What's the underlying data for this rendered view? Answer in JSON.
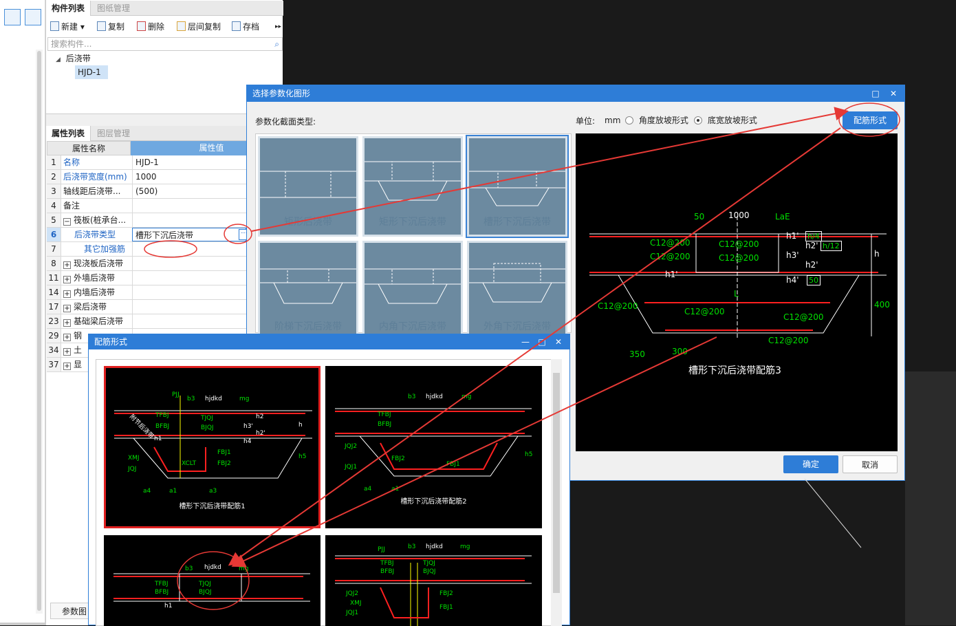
{
  "component_panel": {
    "tabs": [
      "构件列表",
      "图纸管理"
    ],
    "toolbar": [
      "新建",
      "复制",
      "删除",
      "层间复制",
      "存档"
    ],
    "search_placeholder": "搜索构件...",
    "tree": {
      "group": "后浇带",
      "item": "HJD-1"
    }
  },
  "property_panel": {
    "tabs": [
      "属性列表",
      "图层管理"
    ],
    "headers": {
      "name": "属性名称",
      "value": "属性值"
    },
    "rows": [
      {
        "num": "1",
        "name": "名称",
        "value": "HJD-1"
      },
      {
        "num": "2",
        "name": "后浇带宽度(mm)",
        "value": "1000"
      },
      {
        "num": "3",
        "name": "轴线距后浇带...",
        "value": "(500)"
      },
      {
        "num": "4",
        "name": "备注",
        "value": ""
      },
      {
        "num": "5",
        "name": "筏板(桩承台...",
        "value": ""
      },
      {
        "num": "6",
        "name": "后浇带类型",
        "value": "槽形下沉后浇带"
      },
      {
        "num": "7",
        "name": "其它加强筋",
        "value": ""
      },
      {
        "num": "8",
        "name": "现浇板后浇带",
        "value": ""
      },
      {
        "num": "11",
        "name": "外墙后浇带",
        "value": ""
      },
      {
        "num": "14",
        "name": "内墙后浇带",
        "value": ""
      },
      {
        "num": "17",
        "name": "梁后浇带",
        "value": ""
      },
      {
        "num": "23",
        "name": "基础梁后浇带",
        "value": ""
      },
      {
        "num": "29",
        "name": "钢",
        "value": ""
      },
      {
        "num": "34",
        "name": "土",
        "value": ""
      },
      {
        "num": "37",
        "name": "显",
        "value": ""
      }
    ],
    "bottom_button": "参数图"
  },
  "select_dialog": {
    "title": "选择参数化图形",
    "type_label": "参数化截面类型:",
    "unit_label": "单位:",
    "unit_value": "mm",
    "radio_angle": "角度放坡形式",
    "radio_bottom": "底宽放坡形式",
    "rebar_button": "配筋形式",
    "tiles": [
      "矩形后浇带",
      "矩形下沉后浇带",
      "槽形下沉后浇带",
      "阶梯下沉后浇带",
      "内角下沉后浇带",
      "外角下沉后浇带"
    ],
    "preview": {
      "caption": "槽形下沉后浇带配筋3",
      "dim_50": "50",
      "dim_1000": "1000",
      "dim_lae": "LaE",
      "rebar_1": "C12@200",
      "rebar_2": "C12@200",
      "rebar_3": "C12@200",
      "rebar_4": "C12@200",
      "rebar_5": "C12@200",
      "rebar_6": "C12@200",
      "rebar_7": "C12@200",
      "rebar_8": "C12@200",
      "h1": "h1'",
      "h2": "h2'",
      "h3": "h3'",
      "h2b": "h2'",
      "h1b": "h1'",
      "h4": "h4'",
      "h4_frac": "h/4",
      "h12_frac": "h/12",
      "v50": "50",
      "h": "h",
      "v400": "400",
      "l": "L",
      "d350": "350",
      "d300": "300"
    },
    "ok": "确定",
    "cancel": "取消"
  },
  "rebar_dialog": {
    "title": "配筋形式",
    "options": [
      {
        "caption": "槽形下沉后浇带配筋1"
      },
      {
        "caption": "槽形下沉后浇带配筋2"
      },
      {
        "caption": ""
      },
      {
        "caption": ""
      }
    ],
    "cad_labels": {
      "pjj": "PJJ",
      "b3": "b3",
      "hjdkd": "hjdkd",
      "mg": "mg",
      "tfbj": "TFBJ",
      "bfbj": "BFBJ",
      "tjqj": "TJQJ",
      "bjqj": "BJQJ",
      "hl": "h1",
      "h2": "h2",
      "h3": "h3'",
      "h2p": "h2'",
      "h4": "h4",
      "h": "h",
      "xmj": "XMJ",
      "jqj": "JQJ",
      "xclt": "XCLT",
      "fbj1": "FBJ1",
      "fbj2": "FBJ2",
      "a4": "a4",
      "a1": "a1",
      "a3": "a3",
      "h5": "h5",
      "jqj2": "JQJ2",
      "jqj1": "JQJ1",
      "diag": "附节后浇带"
    }
  },
  "colors": {
    "accent": "#2e7dd7",
    "annotation": "#e53935",
    "cad_green": "#00e000",
    "cad_red": "#ff2020"
  }
}
